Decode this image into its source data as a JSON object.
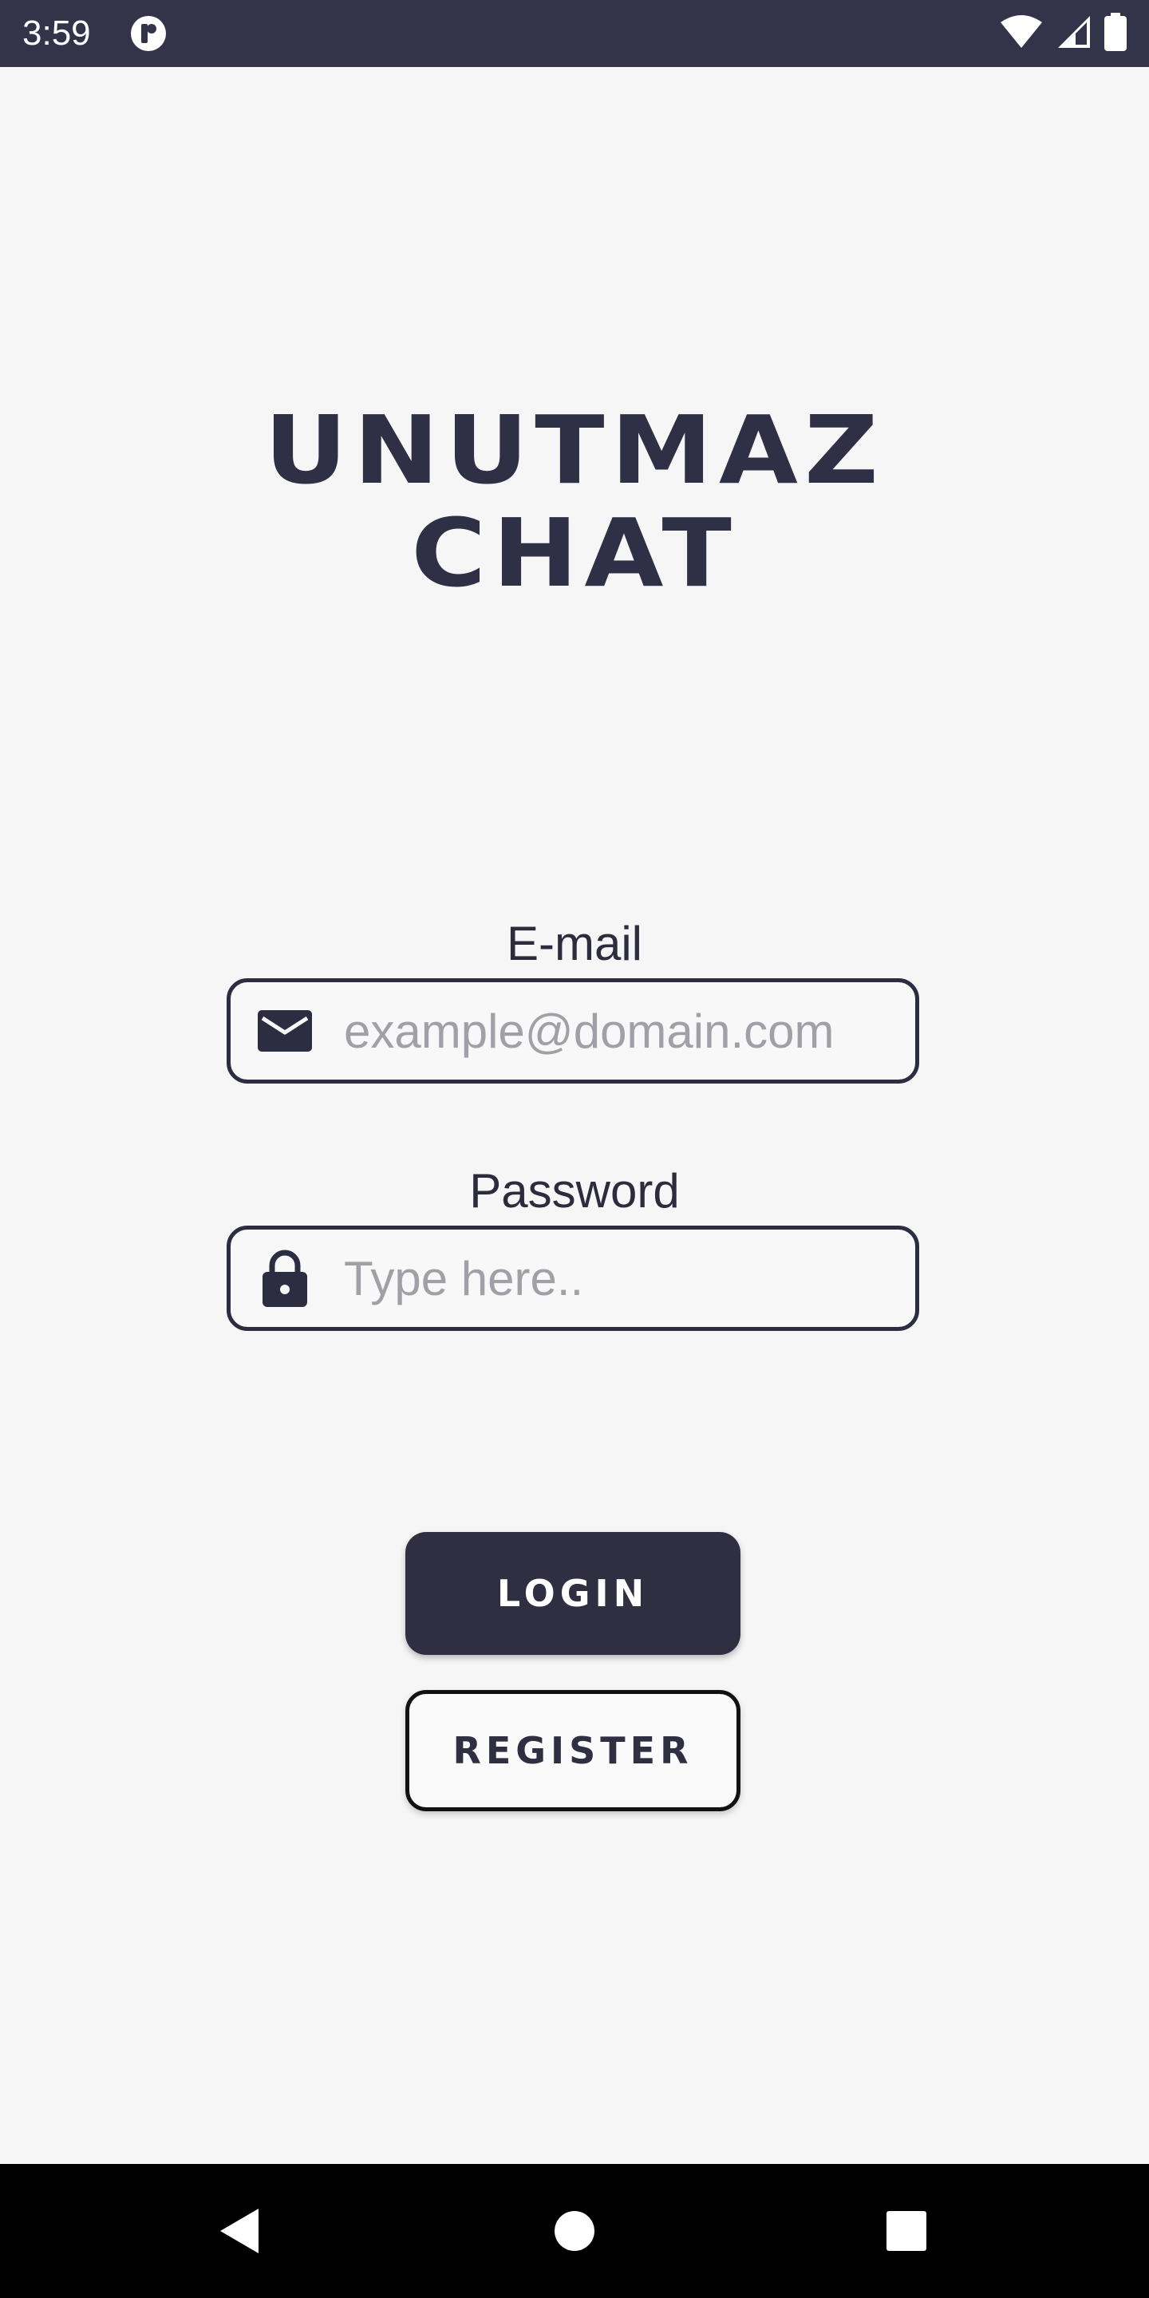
{
  "status_bar": {
    "time": "3:59",
    "icons": [
      "app-notification-icon",
      "wifi-icon",
      "cell-signal-icon",
      "battery-icon"
    ]
  },
  "app": {
    "title_line1": "UNUTMAZ",
    "title_line2": "CHAT"
  },
  "form": {
    "email": {
      "label": "E-mail",
      "placeholder": "example@domain.com",
      "icon": "envelope-icon"
    },
    "password": {
      "label": "Password",
      "placeholder": "Type here..",
      "icon": "lock-icon"
    }
  },
  "buttons": {
    "login_label": "LOGIN",
    "register_label": "REGISTER"
  },
  "nav_bar": {
    "icons": [
      "back-icon",
      "home-icon",
      "recents-icon"
    ]
  },
  "colors": {
    "primary": "#2f2f41",
    "status_bar": "#33344a",
    "background": "#f6f6f6",
    "placeholder": "#a0a0a6"
  }
}
